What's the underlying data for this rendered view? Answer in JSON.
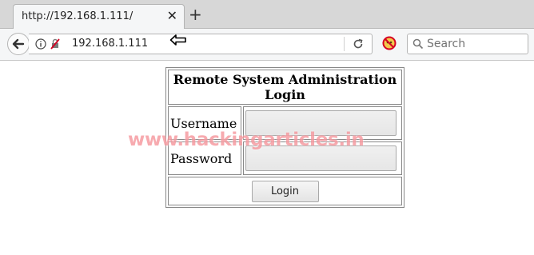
{
  "browser": {
    "tab_title": "http://192.168.1.111/",
    "close_glyph": "✕",
    "new_tab_glyph": "+",
    "url": "192.168.1.111",
    "search_placeholder": "Search"
  },
  "page": {
    "title": "Remote System Administration Login",
    "username_label": "Username",
    "username_value": "",
    "password_label": "Password",
    "password_value": "",
    "login_button": "Login"
  },
  "watermark": "www.hackingarticles.in",
  "icons": [
    "back-arrow-icon",
    "info-icon",
    "mixed-content-icon",
    "reload-icon",
    "block-icon",
    "search-icon",
    "pointer-arrow-icon"
  ]
}
